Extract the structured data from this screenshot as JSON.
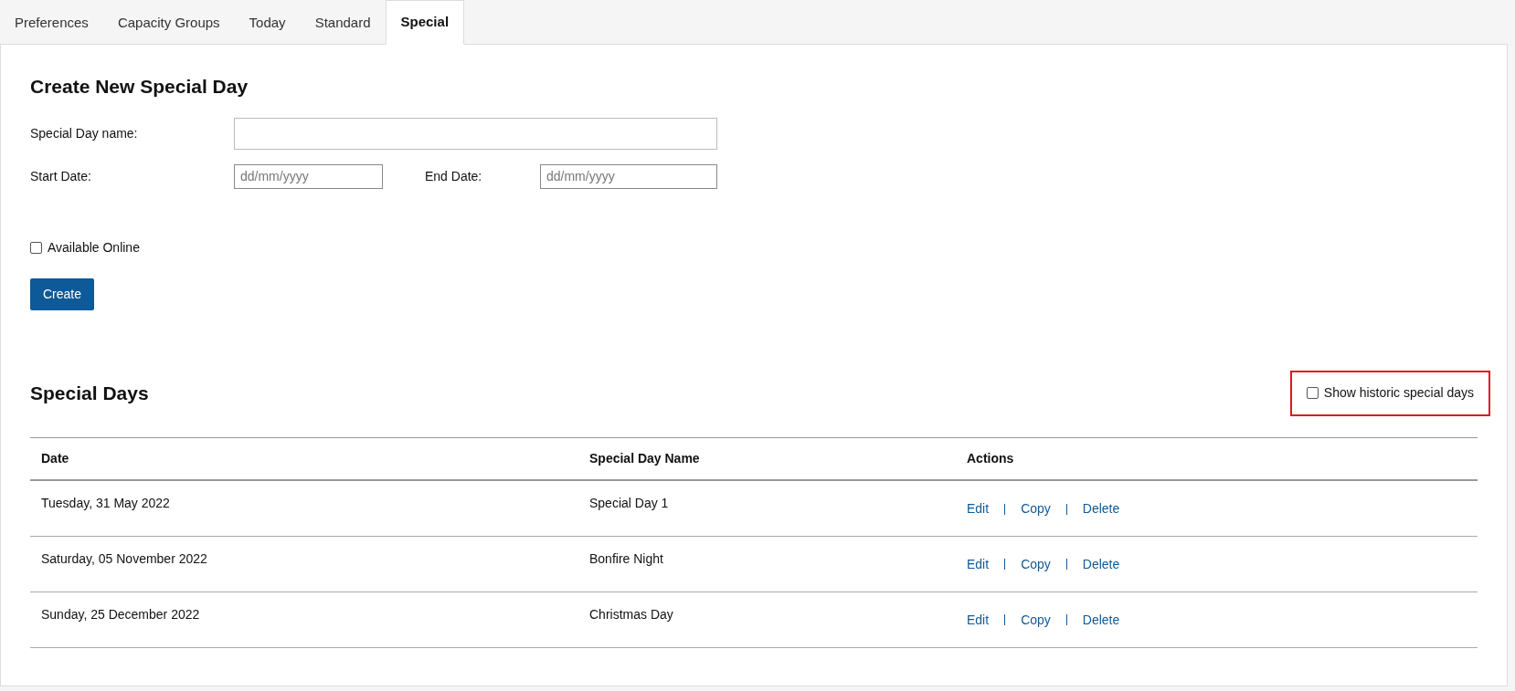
{
  "tabs": [
    {
      "label": "Preferences",
      "selected": false
    },
    {
      "label": "Capacity Groups",
      "selected": false
    },
    {
      "label": "Today",
      "selected": false
    },
    {
      "label": "Standard",
      "selected": false
    },
    {
      "label": "Special",
      "selected": true
    }
  ],
  "create_form": {
    "title": "Create New Special Day",
    "name_label": "Special Day name:",
    "start_label": "Start Date:",
    "start_placeholder": "dd/mm/yyyy",
    "end_label": "End Date:",
    "end_placeholder": "dd/mm/yyyy",
    "available_online": {
      "label": "Available Online",
      "checked": false
    },
    "create_button": "Create"
  },
  "special_days": {
    "title": "Special Days",
    "show_historic": {
      "label": "Show historic special days",
      "checked": false
    },
    "table": {
      "columns": [
        "Date",
        "Special Day Name",
        "Actions"
      ],
      "rows": [
        {
          "date": "Tuesday, 31 May 2022",
          "name": "Special Day 1",
          "actions": [
            "Edit",
            "Copy",
            "Delete"
          ]
        },
        {
          "date": "Saturday, 05 November 2022",
          "name": "Bonfire Night",
          "actions": [
            "Edit",
            "Copy",
            "Delete"
          ]
        },
        {
          "date": "Sunday, 25 December 2022",
          "name": "Christmas Day",
          "actions": [
            "Edit",
            "Copy",
            "Delete"
          ]
        }
      ]
    }
  }
}
